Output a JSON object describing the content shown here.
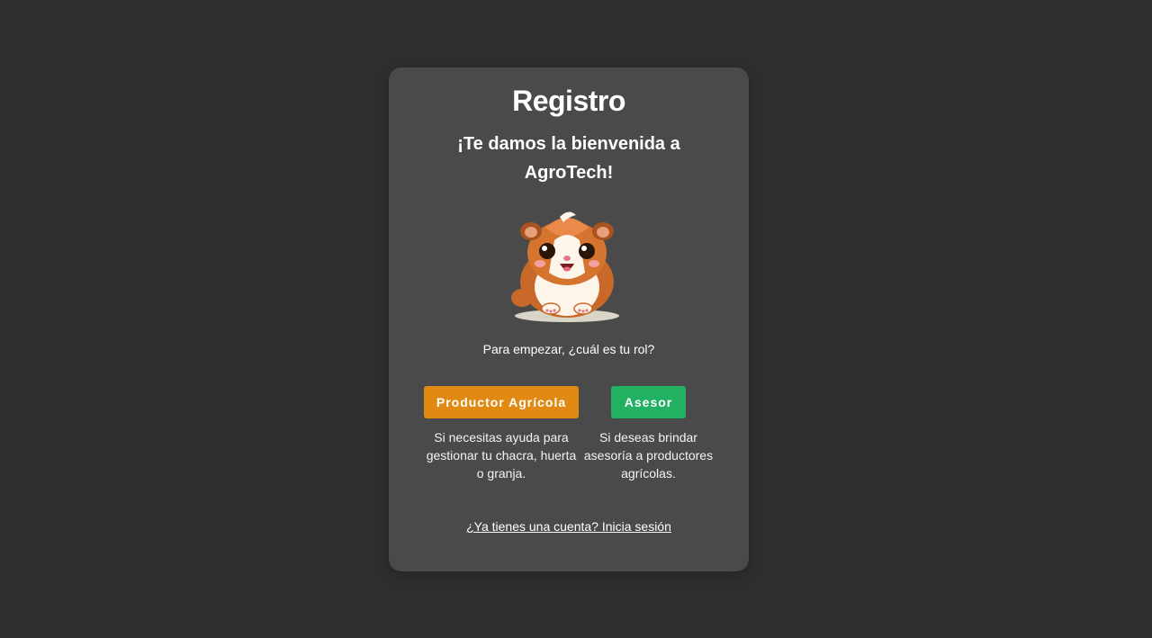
{
  "page": {
    "title": "Registro",
    "welcome": "¡Te damos la bienvenida a AgroTech!",
    "prompt": "Para empezar, ¿cuál es tu rol?",
    "login_link": "¿Ya tienes una cuenta? Inicia sesión"
  },
  "mascot": {
    "icon": "guinea-pig-mascot"
  },
  "roles": [
    {
      "label": "Productor Agrícola",
      "description": "Si necesitas ayuda para gestionar tu chacra, huerta o granja.",
      "color": "#e08a13"
    },
    {
      "label": "Asesor",
      "description": "Si deseas brindar asesoría a productores agrícolas.",
      "color": "#22b163"
    }
  ],
  "colors": {
    "background": "#2f2f2f",
    "card": "#4a4a4a",
    "text": "#ffffff"
  }
}
